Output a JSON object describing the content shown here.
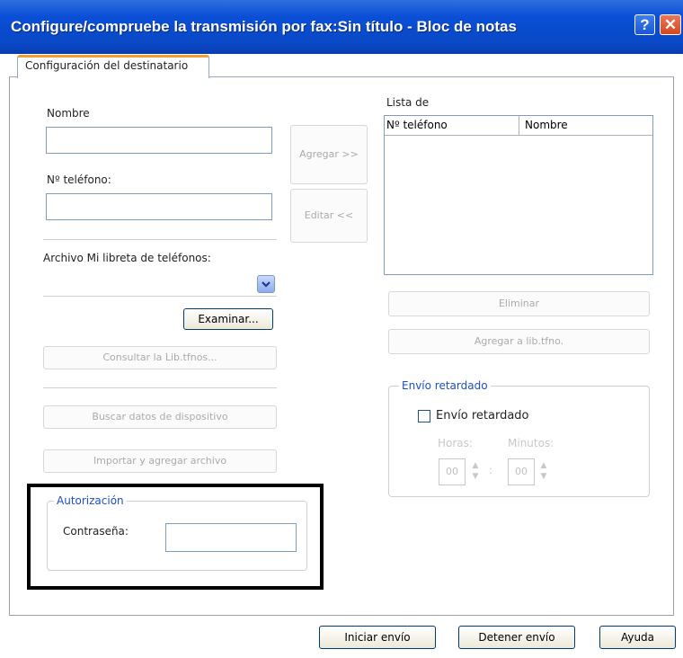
{
  "window": {
    "title": "Configure/compruebe la transmisión por fax:Sin título - Bloc de notas",
    "help_glyph": "?",
    "close_glyph": "✕"
  },
  "tab": {
    "label": "Configuración del destinatario"
  },
  "form": {
    "name_label": "Nombre",
    "name_value": "",
    "phone_label": "Nº teléfono:",
    "phone_value": "",
    "phonebook_label": "Archivo Mi libreta de teléfonos:",
    "phonebook_value": "",
    "browse_button": "Examinar...",
    "consult_button": "Consultar la Lib.tfnos...",
    "search_device_button": "Buscar datos de dispositivo",
    "import_button": "Importar y agregar archivo"
  },
  "middle": {
    "add_button": "Agregar >>",
    "edit_button": "Editar <<"
  },
  "list": {
    "label": "Lista de",
    "columns": [
      "Nº teléfono",
      "Nombre"
    ],
    "rows": [],
    "delete_button": "Eliminar",
    "add_to_phonebook_button": "Agregar a lib.tfno."
  },
  "delayed": {
    "group_title": "Envío retardado",
    "checkbox_label": "Envío retardado",
    "checked": false,
    "hours_label": "Horas:",
    "minutes_label": "Minutos:",
    "hours_value": "00",
    "minutes_value": "00"
  },
  "auth": {
    "group_title": "Autorización",
    "password_label": "Contraseña:",
    "password_value": ""
  },
  "footer": {
    "start_button": "Iniciar envío",
    "stop_button": "Detener envío",
    "help_button": "Ayuda"
  },
  "colors": {
    "title_bar": "#0a4fd6",
    "group_title": "#1a4fc8",
    "close_button": "#d6461e",
    "highlight_border": "#000000"
  }
}
